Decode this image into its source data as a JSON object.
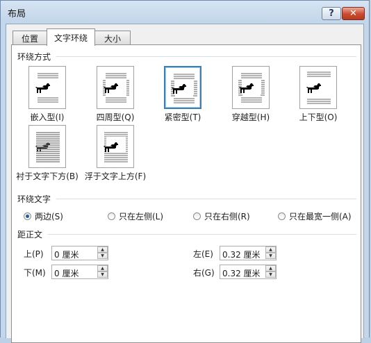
{
  "window": {
    "title": "布局",
    "help": "?",
    "close": "✕"
  },
  "tabs": [
    {
      "label": "位置",
      "active": false
    },
    {
      "label": "文字环绕",
      "active": true
    },
    {
      "label": "大小",
      "active": false
    }
  ],
  "wrap_section": {
    "title": "环绕方式",
    "options": [
      {
        "label": "嵌入型(I)",
        "icon": "inline-wrap-icon",
        "selected": false
      },
      {
        "label": "四周型(Q)",
        "icon": "square-wrap-icon",
        "selected": false
      },
      {
        "label": "紧密型(T)",
        "icon": "tight-wrap-icon",
        "selected": true
      },
      {
        "label": "穿越型(H)",
        "icon": "through-wrap-icon",
        "selected": false
      },
      {
        "label": "上下型(O)",
        "icon": "top-bottom-wrap-icon",
        "selected": false
      },
      {
        "label": "衬于文字下方(B)",
        "icon": "behind-text-icon",
        "selected": false
      },
      {
        "label": "浮于文字上方(F)",
        "icon": "in-front-text-icon",
        "selected": false
      }
    ]
  },
  "text_section": {
    "title": "环绕文字",
    "options": [
      {
        "label": "两边(S)",
        "selected": true
      },
      {
        "label": "只在左侧(L)",
        "selected": false
      },
      {
        "label": "只在右侧(R)",
        "selected": false
      },
      {
        "label": "只在最宽一侧(A)",
        "selected": false
      }
    ]
  },
  "distance_section": {
    "title": "距正文",
    "fields": [
      {
        "label": "上(P)",
        "value": "0 厘米"
      },
      {
        "label": "下(M)",
        "value": "0 厘米"
      },
      {
        "label": "左(E)",
        "value": "0.32 厘米"
      },
      {
        "label": "右(G)",
        "value": "0.32 厘米"
      }
    ]
  },
  "colors": {
    "accent": "#3c7fb1",
    "close": "#c84a2f"
  }
}
